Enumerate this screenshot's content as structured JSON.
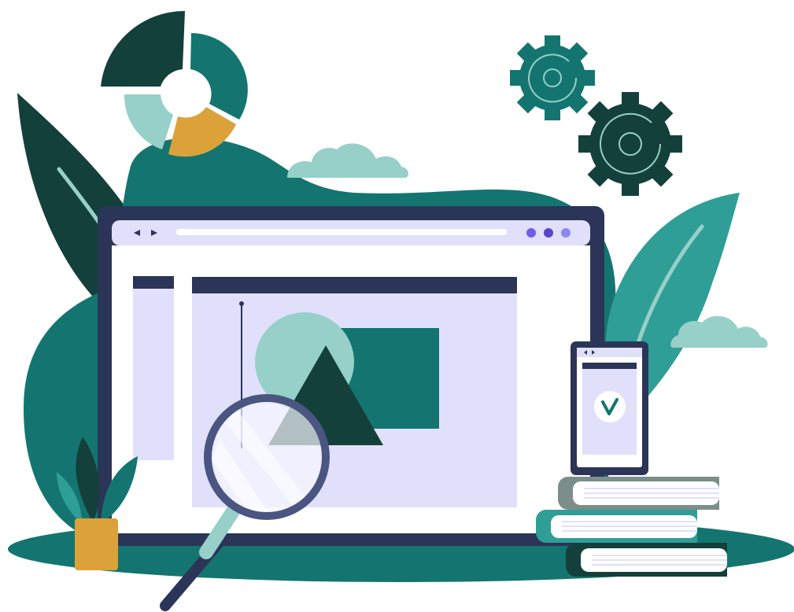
{
  "palette": {
    "dark_green": "#13403a",
    "teal": "#147570",
    "mid_teal": "#2f9e96",
    "light_teal": "#96d0c9",
    "mustard": "#dba23a",
    "navy": "#2b3558",
    "lavender": "#e1e0fa",
    "pale": "#f6f6ff",
    "purple_dot_1": "#6d5dea",
    "purple_dot_2": "#5745cc",
    "purple_dot_3": "#8f86f2",
    "book_grey": "#7c8e89",
    "white": "#ffffff"
  },
  "icons": {
    "browser_back": "back-arrow-icon",
    "browser_forward": "forward-arrow-icon",
    "phone_check": "check-icon",
    "magnifier": "magnifying-glass-icon",
    "gears": "gear-icon",
    "donut": "donut-chart-icon",
    "image_placeholder": "image-icon"
  }
}
